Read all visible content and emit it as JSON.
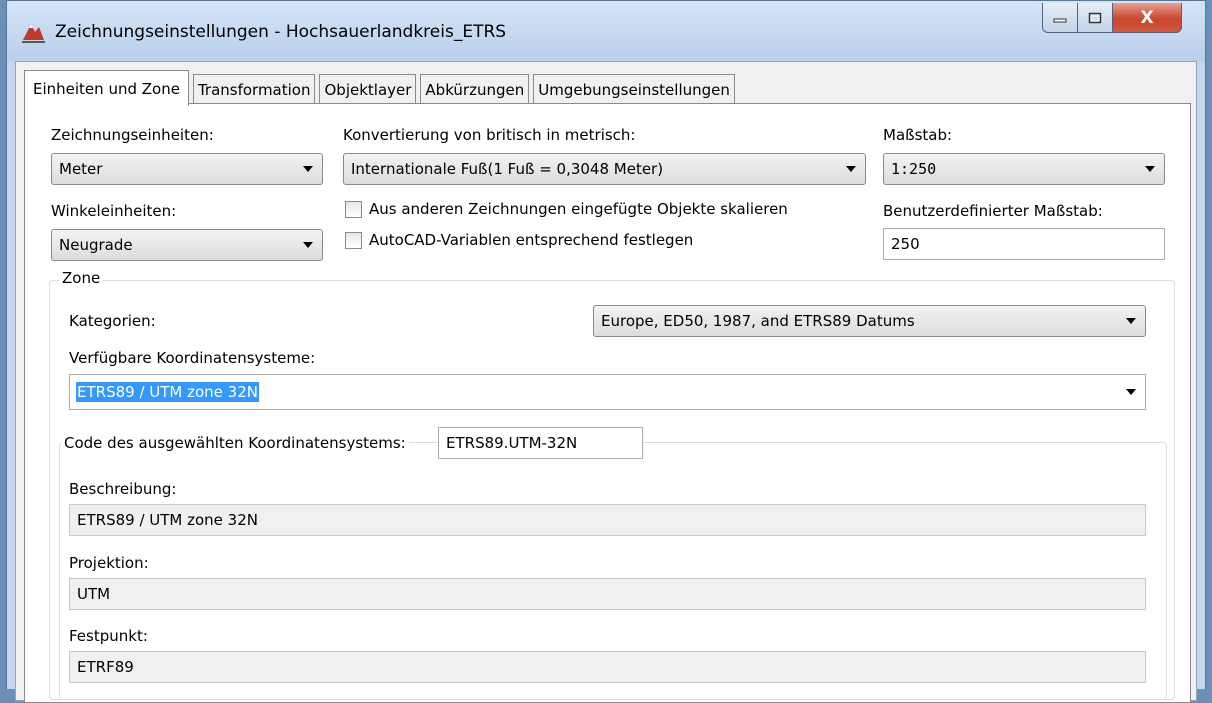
{
  "window": {
    "title": "Zeichnungseinstellungen - Hochsauerlandkreis_ETRS",
    "app_icon": "map-3d-app-icon",
    "controls": {
      "minimize_icon": "minimize-icon",
      "maximize_icon": "maximize-icon",
      "close_label": "X"
    }
  },
  "tabs": [
    {
      "label": "Einheiten und Zone",
      "active": true
    },
    {
      "label": "Transformation"
    },
    {
      "label": "Objektlayer"
    },
    {
      "label": "Abkürzungen"
    },
    {
      "label": "Umgebungseinstellungen"
    }
  ],
  "units": {
    "drawing_units_label": "Zeichnungseinheiten:",
    "drawing_units_value": "Meter",
    "conversion_label": "Konvertierung von britisch in metrisch:",
    "conversion_value": "Internationale Fuß(1 Fuß = 0,3048 Meter)",
    "scale_label": "Maßstab:",
    "scale_value": "1:250",
    "angle_units_label": "Winkeleinheiten:",
    "angle_units_value": "Neugrade",
    "scale_inserted_label": "Aus anderen Zeichnungen eingefügte Objekte skalieren",
    "autocad_vars_label": "AutoCAD-Variablen entsprechend festlegen",
    "custom_scale_label": "Benutzerdefinierter Maßstab:",
    "custom_scale_value": "250"
  },
  "zone": {
    "group_title": "Zone",
    "categories_label": "Kategorien:",
    "categories_value": "Europe, ED50, 1987, and ETRS89 Datums",
    "available_cs_label": "Verfügbare Koordinatensysteme:",
    "available_cs_value": "ETRS89 / UTM zone 32N",
    "code_label": "Code des ausgewählten Koordinatensystems:",
    "code_value": "ETRS89.UTM-32N",
    "description_label": "Beschreibung:",
    "description_value": "ETRS89 / UTM zone 32N",
    "projection_label": "Projektion:",
    "projection_value": "UTM",
    "datum_label": "Festpunkt:",
    "datum_value": "ETRF89"
  },
  "colors": {
    "selection": "#3399ff",
    "close_button": "#c7452d",
    "titlebar": "#b9d1ec"
  }
}
